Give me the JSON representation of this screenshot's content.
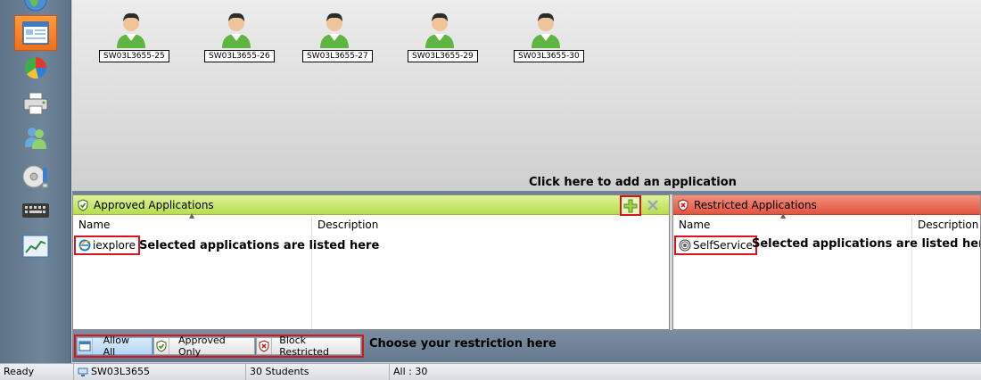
{
  "nav": {
    "items": [
      {
        "name": "globe-icon"
      },
      {
        "name": "classroom-view-icon",
        "active": true
      },
      {
        "name": "pie-chart-icon"
      },
      {
        "name": "printer-icon"
      },
      {
        "name": "users-icon"
      },
      {
        "name": "media-disc-icon"
      },
      {
        "name": "keyboard-icon"
      },
      {
        "name": "line-chart-icon"
      }
    ]
  },
  "stations": [
    {
      "label": "SW03L3655-25"
    },
    {
      "label": "SW03L3655-26"
    },
    {
      "label": "SW03L3655-27"
    },
    {
      "label": "SW03L3655-29"
    },
    {
      "label": "SW03L3655-30"
    }
  ],
  "annotations": {
    "add_hint": "Click here to add an application",
    "approved_hint": "Selected applications are listed here",
    "restricted_hint": "Selected applications are listed here",
    "restriction_hint": "Choose your restriction here"
  },
  "approved": {
    "title": "Approved Applications",
    "col_name": "Name",
    "col_description": "Description",
    "items": [
      {
        "name": "iexplore",
        "icon": "internet-explorer-icon"
      }
    ],
    "header_color": "#b6de4d"
  },
  "restricted": {
    "title": "Restricted Applications",
    "col_name": "Name",
    "col_description": "Description",
    "items": [
      {
        "name": "SelfService",
        "icon": "self-service-icon"
      }
    ],
    "header_color": "#e2543f"
  },
  "toolbar": {
    "allow_all": "Allow All",
    "approved_only": "Approved Only",
    "block_restricted": "Block Restricted",
    "selected": "allow_all"
  },
  "status": {
    "state": "Ready",
    "station": "SW03L3655",
    "students": "30 Students",
    "count": "All : 30"
  },
  "colors": {
    "highlight": "#d9141d",
    "active_nav": "#f16f1a"
  }
}
